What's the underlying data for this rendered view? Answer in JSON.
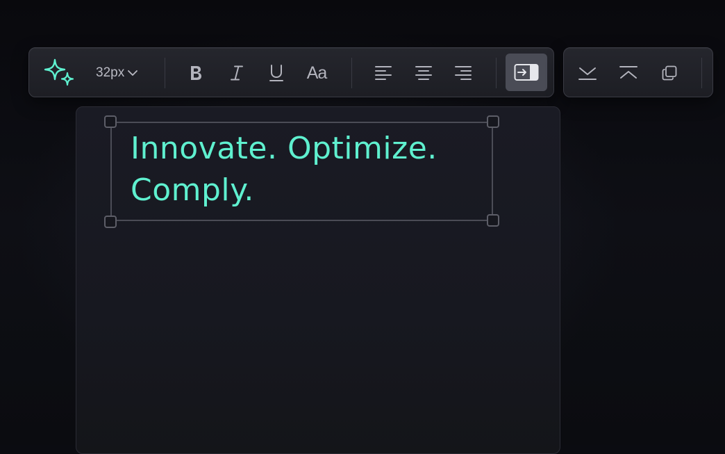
{
  "toolbar": {
    "ai_icon": "sparkle-icon",
    "font_size": "32px",
    "font_size_icon": "chevron-down-icon",
    "format_buttons": [
      {
        "icon": "bold-icon",
        "label": "B"
      },
      {
        "icon": "italic-icon",
        "label": "I"
      },
      {
        "icon": "underline-icon",
        "label": "U"
      },
      {
        "icon": "text-case-icon",
        "label": "Aa"
      }
    ],
    "align_buttons": [
      {
        "icon": "align-left-icon"
      },
      {
        "icon": "align-center-icon"
      },
      {
        "icon": "align-right-icon"
      }
    ],
    "active_button_icon": "insert-into-box-icon",
    "accent_color": "#5ff0cf"
  },
  "toolbar_secondary": {
    "buttons": [
      {
        "icon": "align-bottom-icon"
      },
      {
        "icon": "align-top-icon"
      },
      {
        "icon": "duplicate-icon"
      }
    ]
  },
  "canvas": {
    "headline": "Innovate. Optimize. Comply."
  }
}
